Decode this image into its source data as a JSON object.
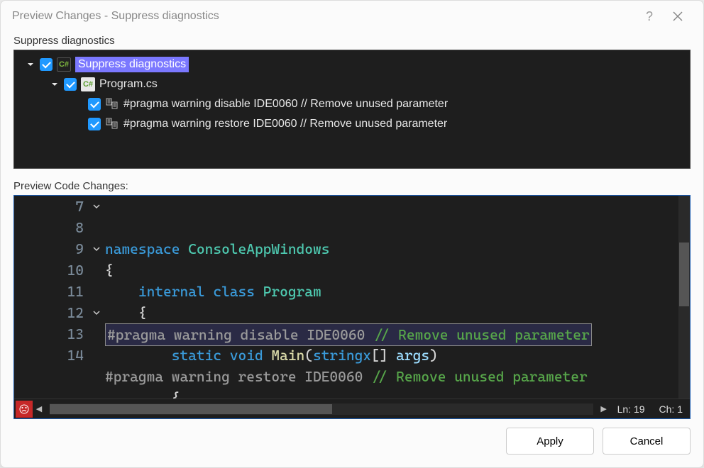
{
  "dialog": {
    "title": "Preview Changes - Suppress diagnostics"
  },
  "tree": {
    "section_label": "Suppress diagnostics",
    "items": [
      {
        "level": 0,
        "expanded": true,
        "checked": true,
        "icon": "csharp-dark",
        "label": "Suppress diagnostics",
        "highlighted": true
      },
      {
        "level": 1,
        "expanded": true,
        "checked": true,
        "icon": "csharp-light",
        "label": "Program.cs",
        "highlighted": false
      },
      {
        "level": 2,
        "expanded": null,
        "checked": true,
        "icon": "file-lines",
        "label": "#pragma warning disable IDE0060 // Remove unused parameter",
        "highlighted": false
      },
      {
        "level": 2,
        "expanded": null,
        "checked": true,
        "icon": "file-lines",
        "label": "#pragma warning restore IDE0060 // Remove unused parameter",
        "highlighted": false
      }
    ]
  },
  "code": {
    "section_label": "Preview Code Changes:",
    "first_line": 7,
    "lines": [
      {
        "num": 7,
        "fold": "v",
        "tokens": [
          [
            "kw",
            "namespace"
          ],
          [
            "sp",
            " "
          ],
          [
            "type",
            "ConsoleAppWindows"
          ]
        ]
      },
      {
        "num": 8,
        "fold": "",
        "tokens": [
          [
            "punct",
            "{"
          ]
        ]
      },
      {
        "num": 9,
        "fold": "v",
        "tokens": [
          [
            "sp",
            "    "
          ],
          [
            "kw",
            "internal"
          ],
          [
            "sp",
            " "
          ],
          [
            "kw",
            "class"
          ],
          [
            "sp",
            " "
          ],
          [
            "type",
            "Program"
          ]
        ]
      },
      {
        "num": 10,
        "fold": "",
        "tokens": [
          [
            "sp",
            "    "
          ],
          [
            "punct",
            "{"
          ]
        ]
      },
      {
        "num": 11,
        "fold": "",
        "boxed": true,
        "tokens": [
          [
            "pragma",
            "#pragma"
          ],
          [
            "sp",
            " "
          ],
          [
            "pragma",
            "warning"
          ],
          [
            "sp",
            " "
          ],
          [
            "pragma",
            "disable"
          ],
          [
            "sp",
            " "
          ],
          [
            "pragma",
            "IDE0060"
          ],
          [
            "sp",
            " "
          ],
          [
            "comment",
            "// Remove unused parameter"
          ]
        ]
      },
      {
        "num": 12,
        "fold": "v",
        "tokens": [
          [
            "sp",
            "        "
          ],
          [
            "kw",
            "static"
          ],
          [
            "sp",
            " "
          ],
          [
            "kw",
            "void"
          ],
          [
            "sp",
            " "
          ],
          [
            "func",
            "Main"
          ],
          [
            "punct",
            "("
          ],
          [
            "kw",
            "stringx"
          ],
          [
            "punct",
            "[]"
          ],
          [
            "sp",
            " "
          ],
          [
            "var",
            "args"
          ],
          [
            "punct",
            ")"
          ]
        ]
      },
      {
        "num": 13,
        "fold": "",
        "tokens": [
          [
            "pragma",
            "#pragma"
          ],
          [
            "sp",
            " "
          ],
          [
            "pragma",
            "warning"
          ],
          [
            "sp",
            " "
          ],
          [
            "pragma",
            "restore"
          ],
          [
            "sp",
            " "
          ],
          [
            "pragma",
            "IDE0060"
          ],
          [
            "sp",
            " "
          ],
          [
            "comment",
            "// Remove unused parameter"
          ]
        ]
      },
      {
        "num": 14,
        "fold": "",
        "tokens": [
          [
            "sp",
            "        "
          ],
          [
            "punct",
            "{"
          ]
        ]
      }
    ],
    "status": {
      "line_label": "Ln:",
      "line": 19,
      "col_label": "Ch:",
      "col": 1
    }
  },
  "buttons": {
    "apply": "Apply",
    "cancel": "Cancel"
  }
}
